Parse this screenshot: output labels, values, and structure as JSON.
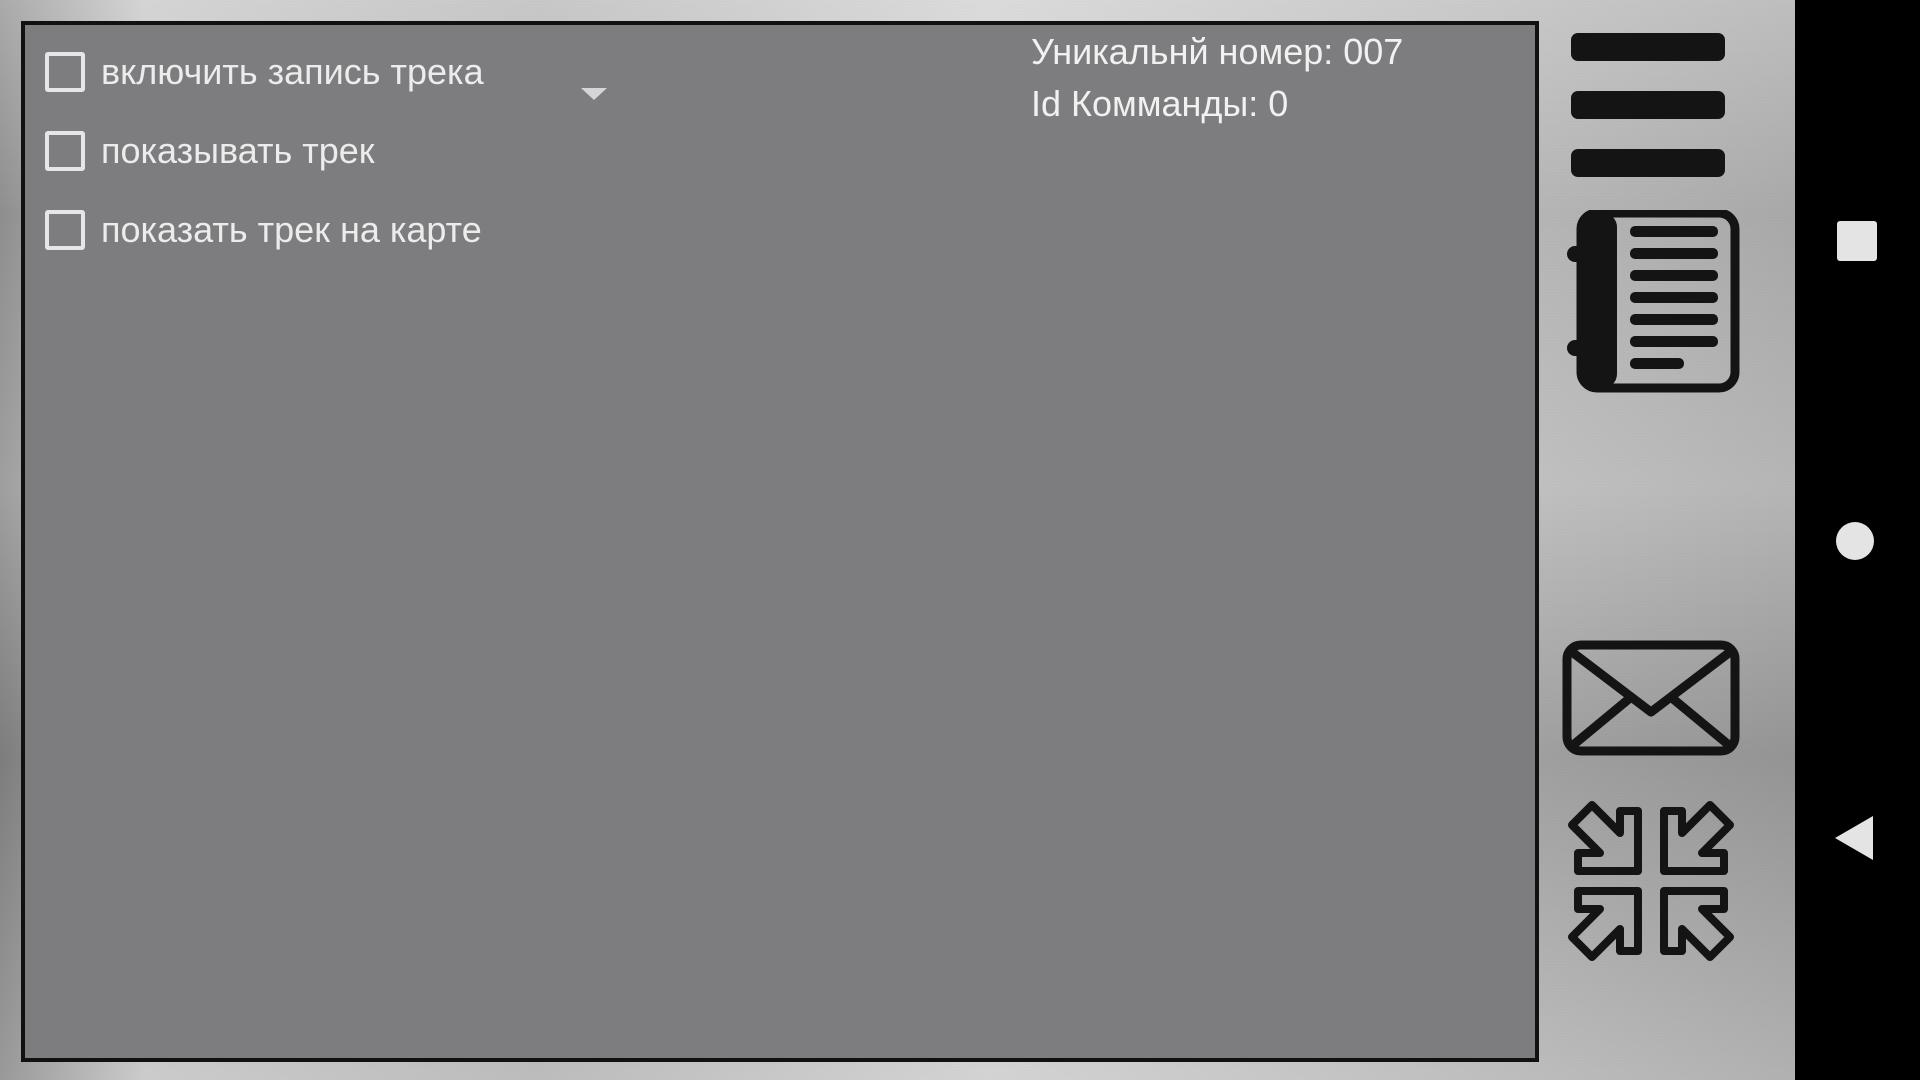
{
  "options": [
    {
      "label": "включить запись трека",
      "checked": false
    },
    {
      "label": "показывать трек",
      "checked": false
    },
    {
      "label": "показать трек на карте",
      "checked": false
    }
  ],
  "info": {
    "unique_number": "Уникальнй номер: 007",
    "team_id": "Id Комманды: 0"
  },
  "toolbar": {
    "icons": [
      "menu-icon",
      "notebook-icon",
      "envelope-icon",
      "collapse-arrows-icon"
    ]
  },
  "navigation": {
    "icons": [
      "recents-square-icon",
      "home-circle-icon",
      "back-triangle-icon"
    ]
  },
  "colors": {
    "panel": "#7d7d7f",
    "panel_border": "#111111",
    "text": "#ececec",
    "icon": "#141414",
    "nav_bar": "#000000"
  }
}
